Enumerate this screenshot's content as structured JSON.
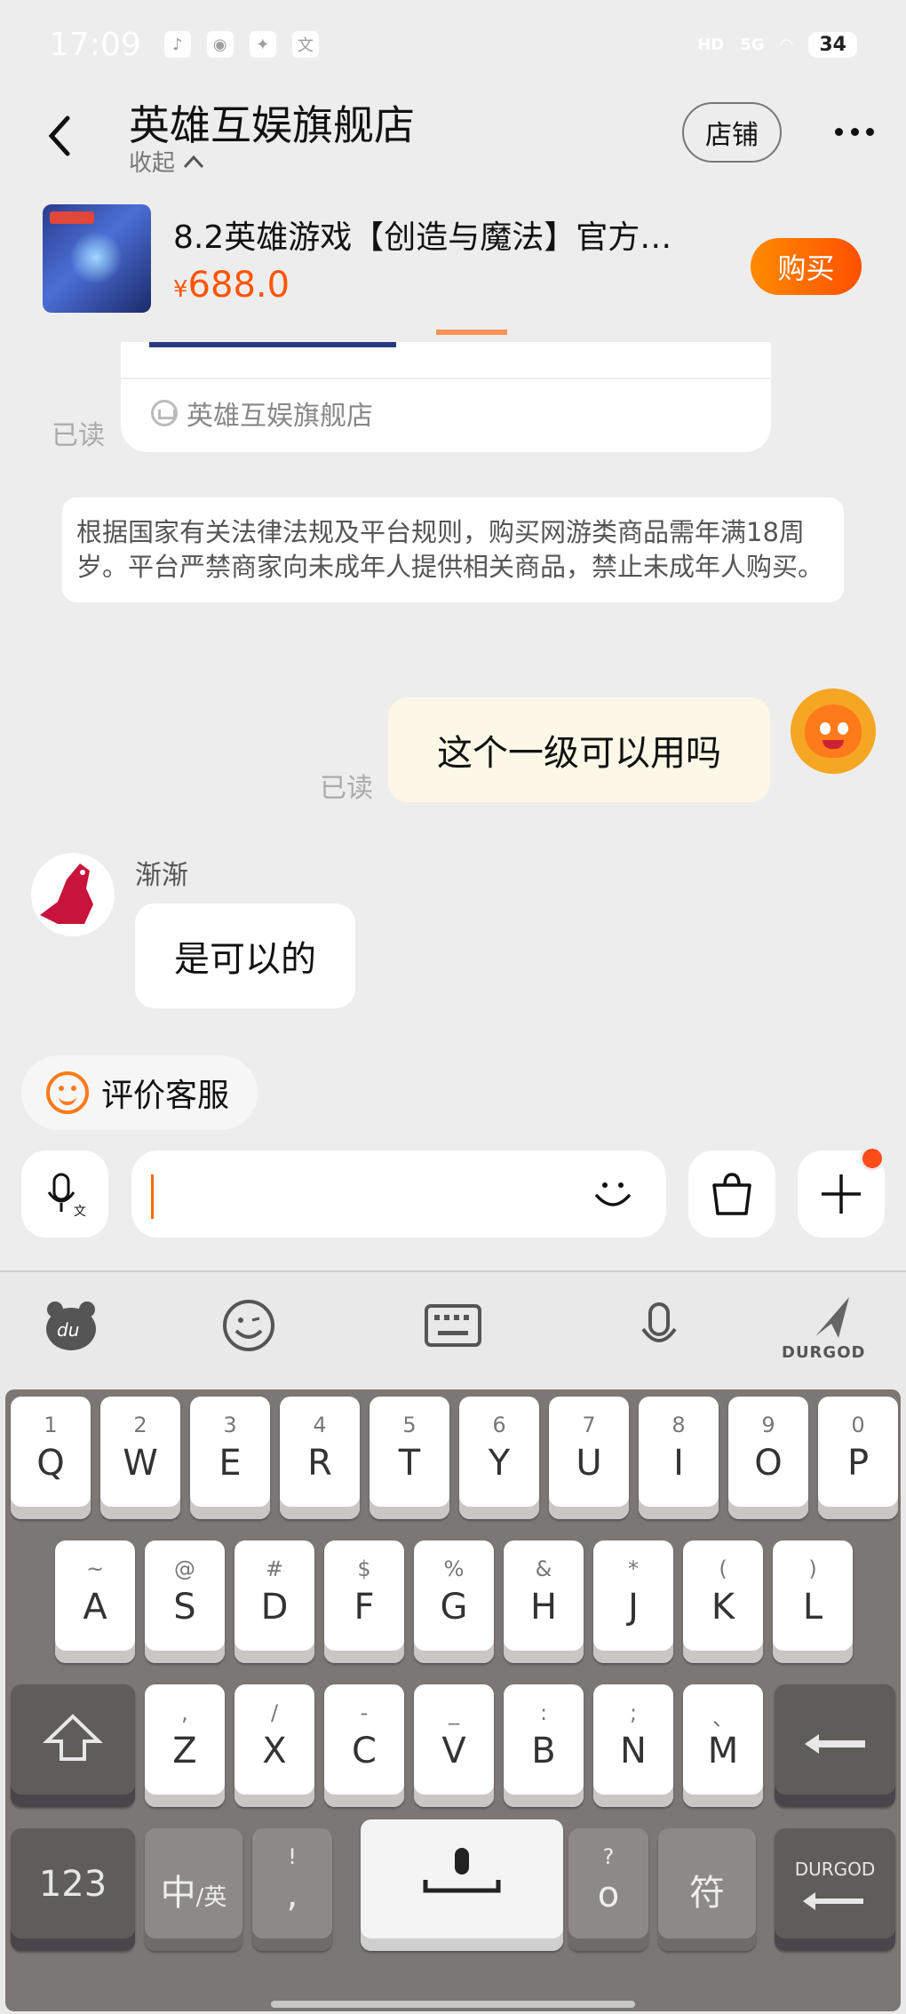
{
  "status": {
    "time": "17:09",
    "battery": "34",
    "network": "5G",
    "hd": "HD"
  },
  "header": {
    "shop_name": "英雄互娱旗舰店",
    "collapse_label": "收起",
    "shop_button": "店铺"
  },
  "product": {
    "title": "8.2英雄游戏【创造与魔法】官方…",
    "currency": "¥",
    "price": "688.0",
    "buy_button": "购买"
  },
  "chat": {
    "card_store": "英雄互娱旗舰店",
    "read_label": "已读",
    "notice": "根据国家有关法律法规及平台规则，购买网游类商品需年满18周岁。平台严禁商家向未成年人提供相关商品，禁止未成年人购买。",
    "my_message": "这个一级可以用吗",
    "my_read_label": "已读",
    "sender_name": "渐渐",
    "reply": "是可以的"
  },
  "rate_chip": {
    "label": "评价客服"
  },
  "input": {
    "value": "",
    "placeholder": ""
  },
  "keyboard": {
    "brand": "DURGOD",
    "row1": [
      {
        "sub": "1",
        "main": "Q"
      },
      {
        "sub": "2",
        "main": "W"
      },
      {
        "sub": "3",
        "main": "E"
      },
      {
        "sub": "4",
        "main": "R"
      },
      {
        "sub": "5",
        "main": "T"
      },
      {
        "sub": "6",
        "main": "Y"
      },
      {
        "sub": "7",
        "main": "U"
      },
      {
        "sub": "8",
        "main": "I"
      },
      {
        "sub": "9",
        "main": "O"
      },
      {
        "sub": "0",
        "main": "P"
      }
    ],
    "row2": [
      {
        "sub": "~",
        "main": "A"
      },
      {
        "sub": "@",
        "main": "S"
      },
      {
        "sub": "#",
        "main": "D"
      },
      {
        "sub": "$",
        "main": "F"
      },
      {
        "sub": "%",
        "main": "G"
      },
      {
        "sub": "&",
        "main": "H"
      },
      {
        "sub": "*",
        "main": "J"
      },
      {
        "sub": "(",
        "main": "K"
      },
      {
        "sub": ")",
        "main": "L"
      }
    ],
    "row3": [
      {
        "sub": ",",
        "main": "Z"
      },
      {
        "sub": "/",
        "main": "X"
      },
      {
        "sub": "-",
        "main": "C"
      },
      {
        "sub": "_",
        "main": "V"
      },
      {
        "sub": ":",
        "main": "B"
      },
      {
        "sub": ";",
        "main": "N"
      },
      {
        "sub": "、",
        "main": "M"
      }
    ],
    "num_key": "123",
    "lang_key_main": "中",
    "lang_key_sub": "/英",
    "punct_key_top": "!",
    "punct_key_bottom": ",",
    "qmark_top": "?",
    "qmark_bottom": "o",
    "symbol_key": "符",
    "enter_key": "DURGOD"
  }
}
